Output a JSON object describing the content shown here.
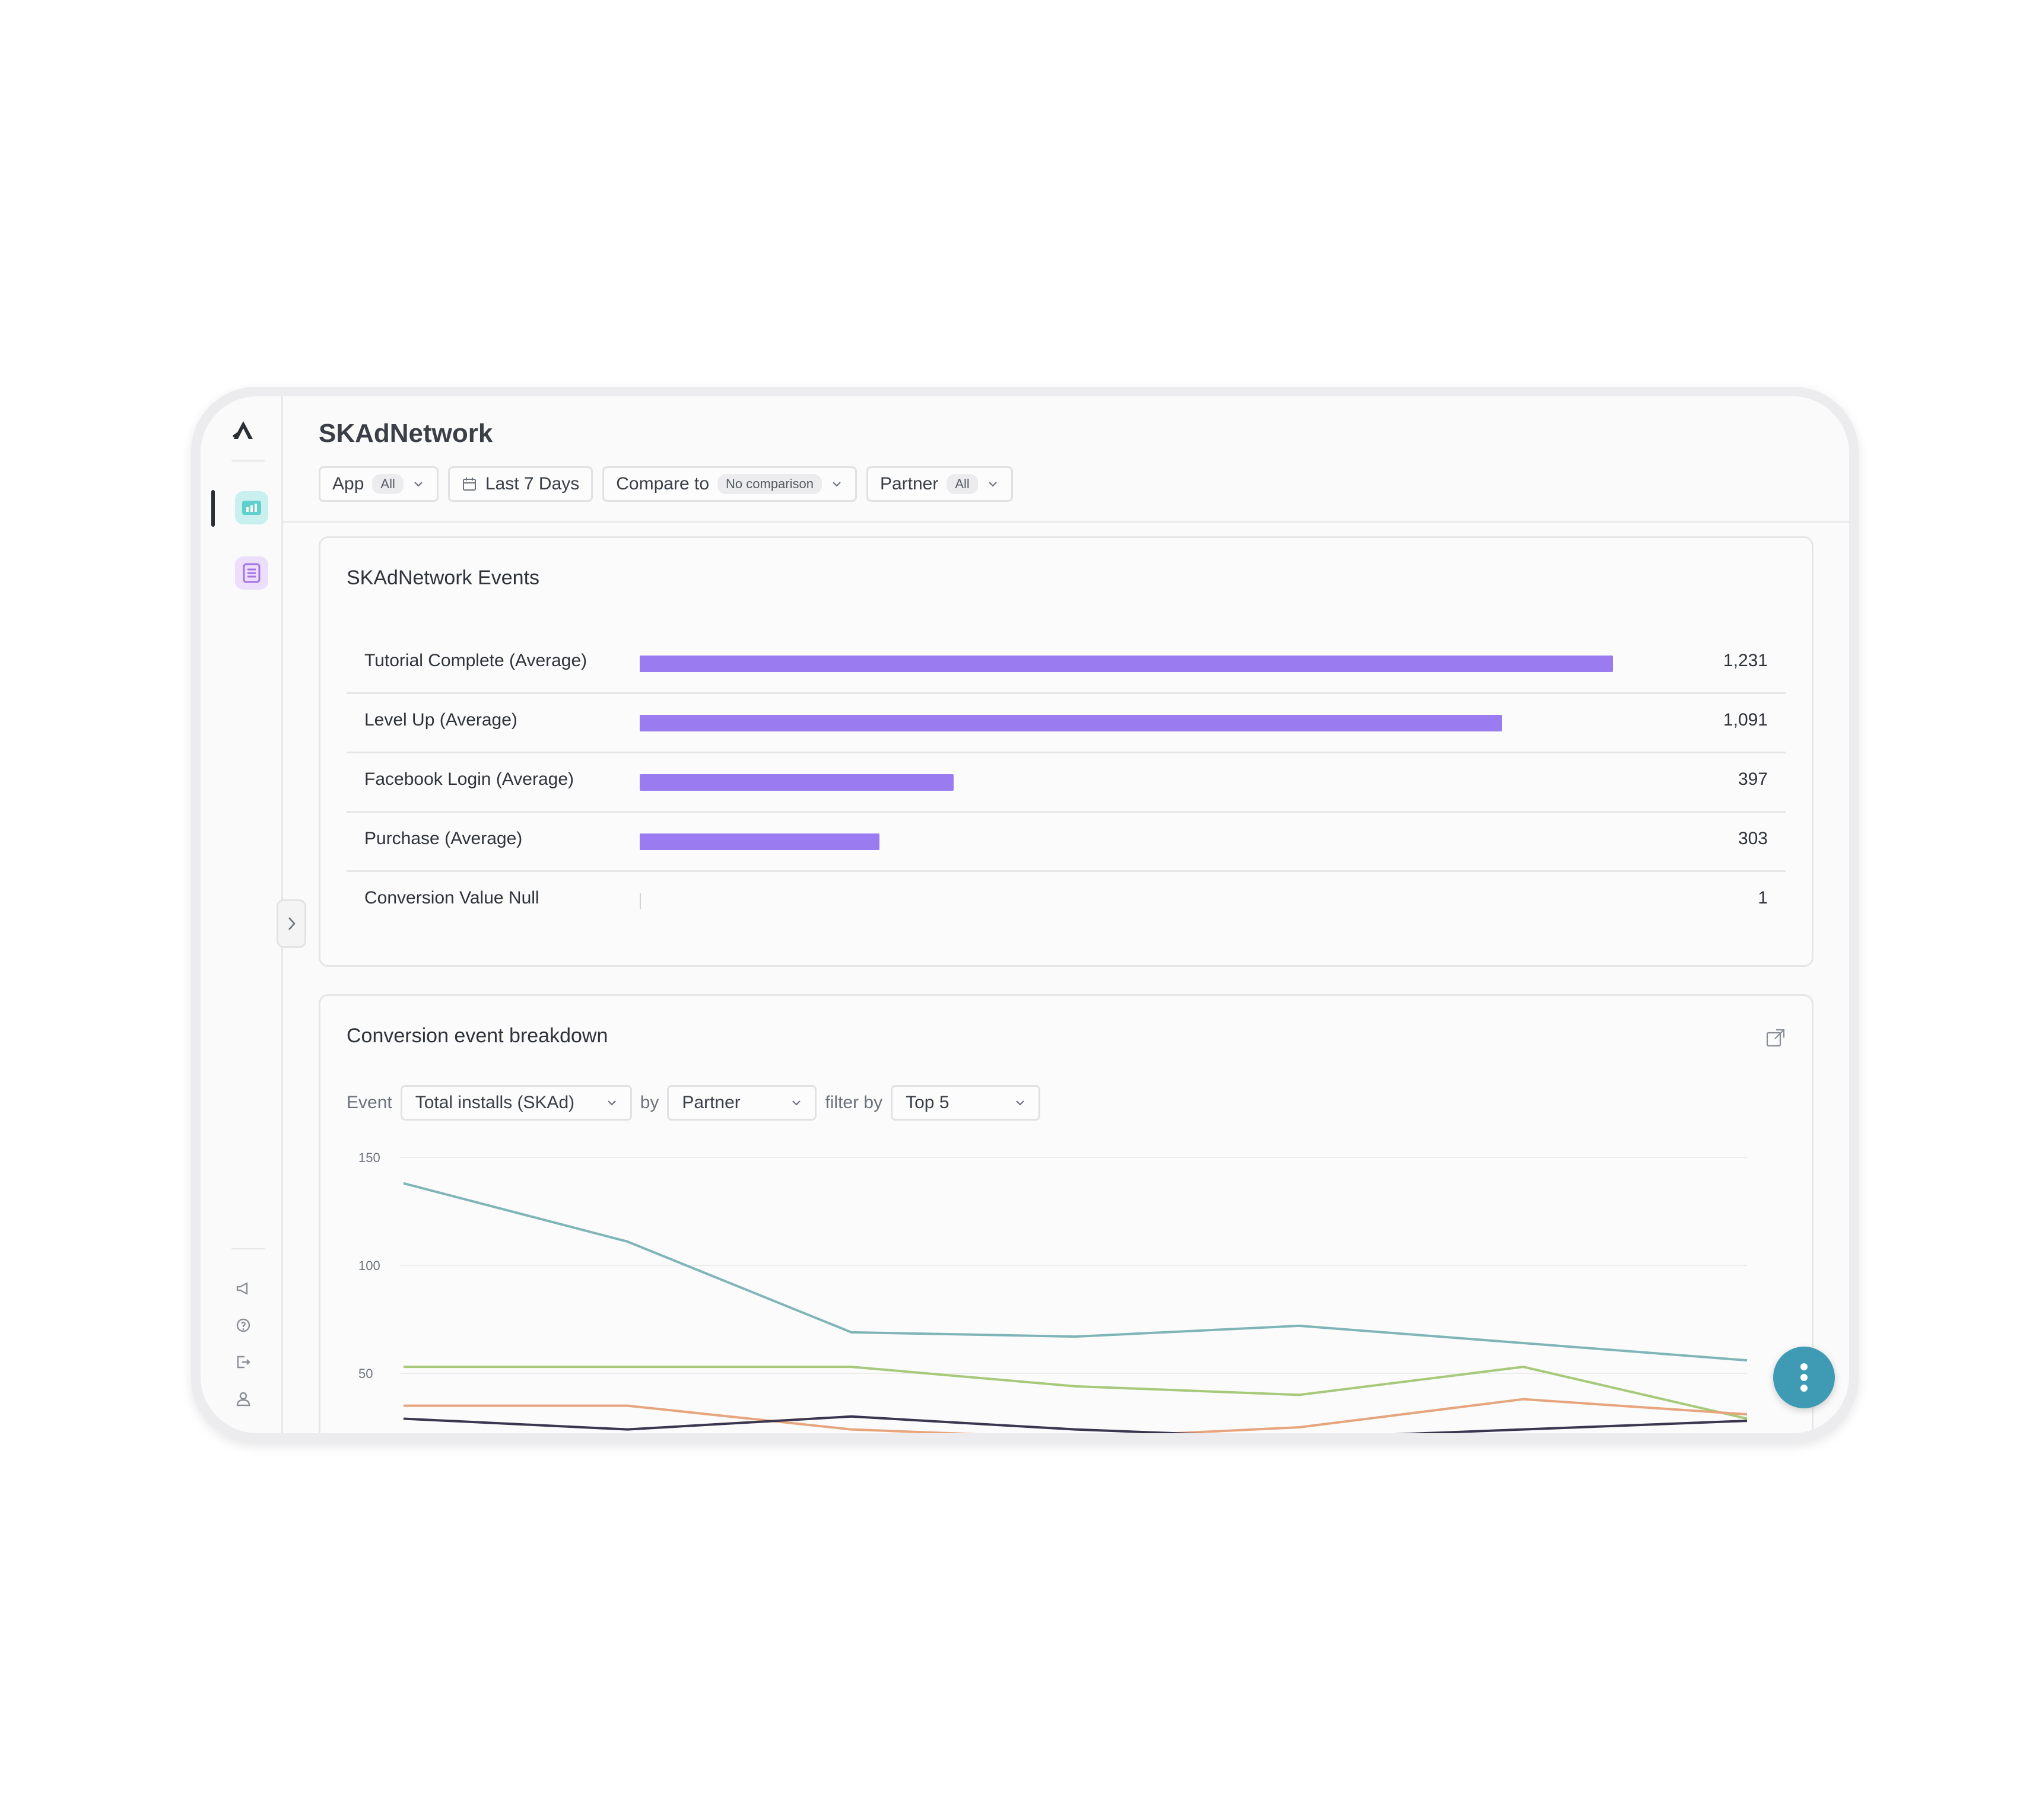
{
  "app": {
    "title": "SKAdNetwork"
  },
  "filters": {
    "app_label": "App",
    "app_value": "All",
    "date_label": "Last 7 Days",
    "compare_label": "Compare to",
    "compare_value": "No comparison",
    "partner_label": "Partner",
    "partner_value": "All"
  },
  "events_card": {
    "title": "SKAdNetwork Events",
    "rows": [
      {
        "label": "Tutorial Complete (Average)",
        "value": "1,231"
      },
      {
        "label": "Level Up (Average)",
        "value": "1,091"
      },
      {
        "label": "Facebook Login (Average)",
        "value": "397"
      },
      {
        "label": "Purchase (Average)",
        "value": "303"
      },
      {
        "label": "Conversion Value Null",
        "value": "1"
      }
    ]
  },
  "breakdown_card": {
    "title": "Conversion event breakdown",
    "event_label": "Event",
    "event_value": "Total installs (SKAd)",
    "by_label": "by",
    "by_value": "Partner",
    "filter_label": "filter by",
    "filter_value": "Top 5"
  },
  "colors": {
    "bar": "#9b7cf0",
    "series": [
      "#7fb5b8",
      "#a6c97a",
      "#e6a57c",
      "#3b3550"
    ],
    "accent": "#3f9bb4"
  },
  "chart_data": {
    "type": "line",
    "x": [
      1,
      2,
      3,
      4,
      5,
      6,
      7
    ],
    "yticks": [
      150,
      100,
      50
    ],
    "ylim": [
      0,
      150
    ],
    "series": [
      {
        "values": [
          138,
          111,
          69,
          67,
          72,
          64,
          56
        ]
      },
      {
        "values": [
          53,
          53,
          53,
          44,
          40,
          53,
          29
        ]
      },
      {
        "values": [
          35,
          35,
          24,
          20,
          25,
          38,
          31
        ]
      },
      {
        "values": [
          29,
          24,
          30,
          24,
          20,
          24,
          28
        ]
      }
    ]
  }
}
